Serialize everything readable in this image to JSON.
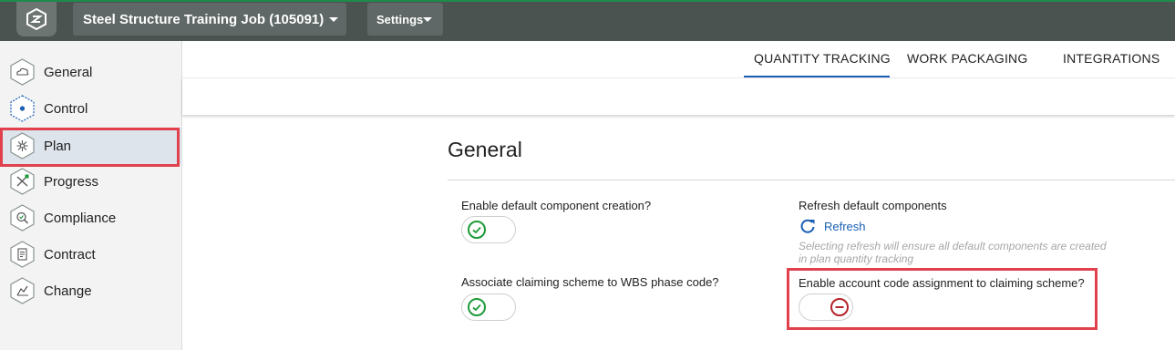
{
  "topbar": {
    "logo_icon": "app-logo-icon",
    "job_select_value": "Steel Structure Training Job (105091)",
    "settings_label": "Settings"
  },
  "sidebar": {
    "items": [
      {
        "label": "General",
        "icon": "cloud-icon"
      },
      {
        "label": "Control",
        "icon": "control-dot-icon"
      },
      {
        "label": "Plan",
        "icon": "plan-burst-icon",
        "active": true
      },
      {
        "label": "Progress",
        "icon": "progress-tools-icon"
      },
      {
        "label": "Compliance",
        "icon": "compliance-search-icon"
      },
      {
        "label": "Contract",
        "icon": "contract-document-icon"
      },
      {
        "label": "Change",
        "icon": "change-chart-icon"
      }
    ]
  },
  "tabs": [
    {
      "label": "QUANTITY TRACKING",
      "active": true
    },
    {
      "label": "WORK PACKAGING"
    },
    {
      "label": "INTEGRATIONS"
    }
  ],
  "section": {
    "title": "General",
    "enable_default_component": {
      "label": "Enable default component creation?",
      "enabled": true
    },
    "refresh_default_components": {
      "label": "Refresh default components",
      "button": "Refresh",
      "hint": "Selecting refresh will ensure all default components are created in plan quantity tracking"
    },
    "associate_claiming_scheme": {
      "label": "Associate claiming scheme to WBS phase code?",
      "enabled": true
    },
    "enable_account_code": {
      "label": "Enable account code assignment to claiming scheme?",
      "enabled": false
    }
  },
  "colors": {
    "topbar": "#4a5350",
    "accent_blue": "#1a5fb4",
    "success_green": "#1f9a3a",
    "danger_red": "#b5232b",
    "highlight_red": "#e0414d"
  }
}
